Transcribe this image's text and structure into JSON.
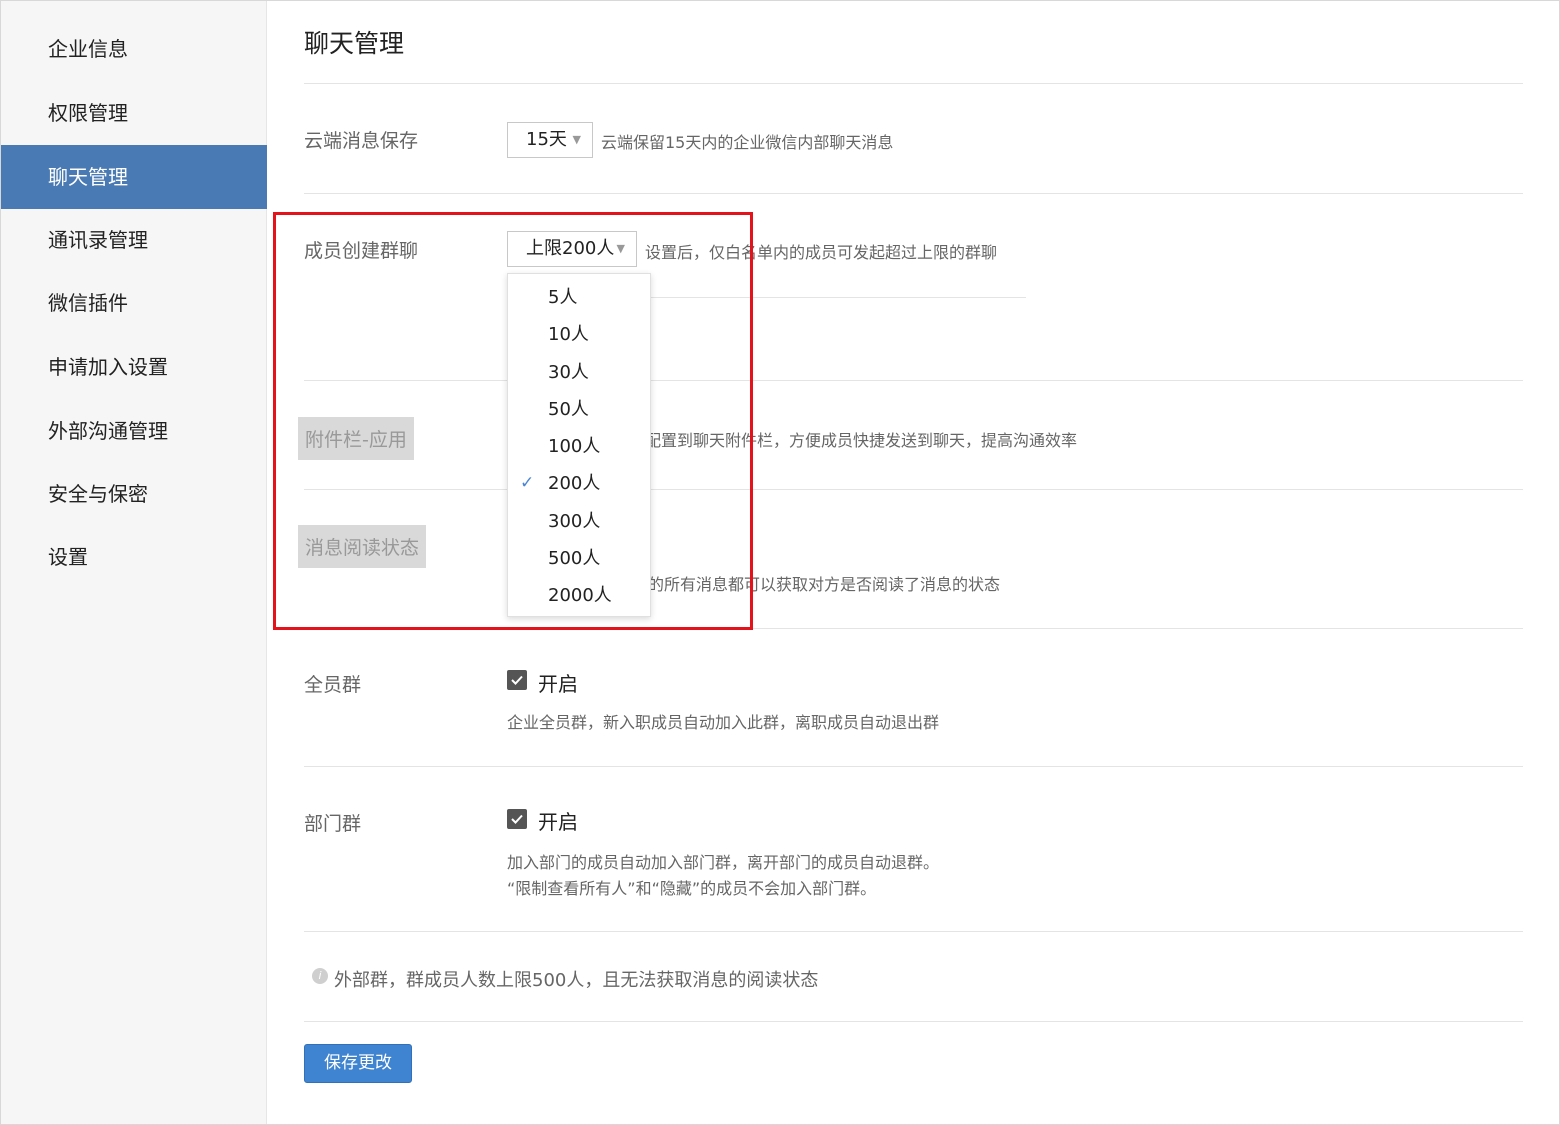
{
  "sidebar": {
    "items": [
      {
        "label": "企业信息"
      },
      {
        "label": "权限管理"
      },
      {
        "label": "聊天管理",
        "active": true
      },
      {
        "label": "通讯录管理"
      },
      {
        "label": "微信插件"
      },
      {
        "label": "申请加入设置"
      },
      {
        "label": "外部沟通管理"
      },
      {
        "label": "安全与保密"
      },
      {
        "label": "设置"
      }
    ]
  },
  "main": {
    "title": "聊天管理",
    "cloud_storage": {
      "label": "云端消息保存",
      "select_value": "15天",
      "description": "云端保留15天内的企业微信内部聊天消息"
    },
    "member_group": {
      "label": "成员创建群聊",
      "select_value": "上限200人",
      "description": "设置后，仅白名单内的成员可发起超过上限的群聊",
      "dropdown_options": [
        "5人",
        "10人",
        "30人",
        "50人",
        "100人",
        "200人",
        "300人",
        "500人",
        "2000人"
      ],
      "selected_option": "200人"
    },
    "attachment_bar": {
      "label": "附件栏-应用",
      "description_partial": "配置到聊天附件栏，方便成员快捷发送到聊天，提高沟通效率"
    },
    "read_status": {
      "label": "消息阅读状态",
      "description_partial": "的所有消息都可以获取对方是否阅读了消息的状态"
    },
    "all_staff_group": {
      "label": "全员群",
      "checkbox_label": "开启",
      "checked": true,
      "description": "企业全员群，新入职成员自动加入此群，离职成员自动退出群"
    },
    "department_group": {
      "label": "部门群",
      "checkbox_label": "开启",
      "checked": true,
      "description_line1": "加入部门的成员自动加入部门群，离开部门的成员自动退群。",
      "description_line2": "“限制查看所有人”和“隐藏”的成员不会加入部门群。"
    },
    "external_note": "外部群，群成员人数上限500人，且无法获取消息的阅读状态",
    "save_button": "保存更改"
  },
  "colors": {
    "accent": "#4a7ab3",
    "button": "#3f84d0",
    "highlight_box": "#e3121b"
  }
}
